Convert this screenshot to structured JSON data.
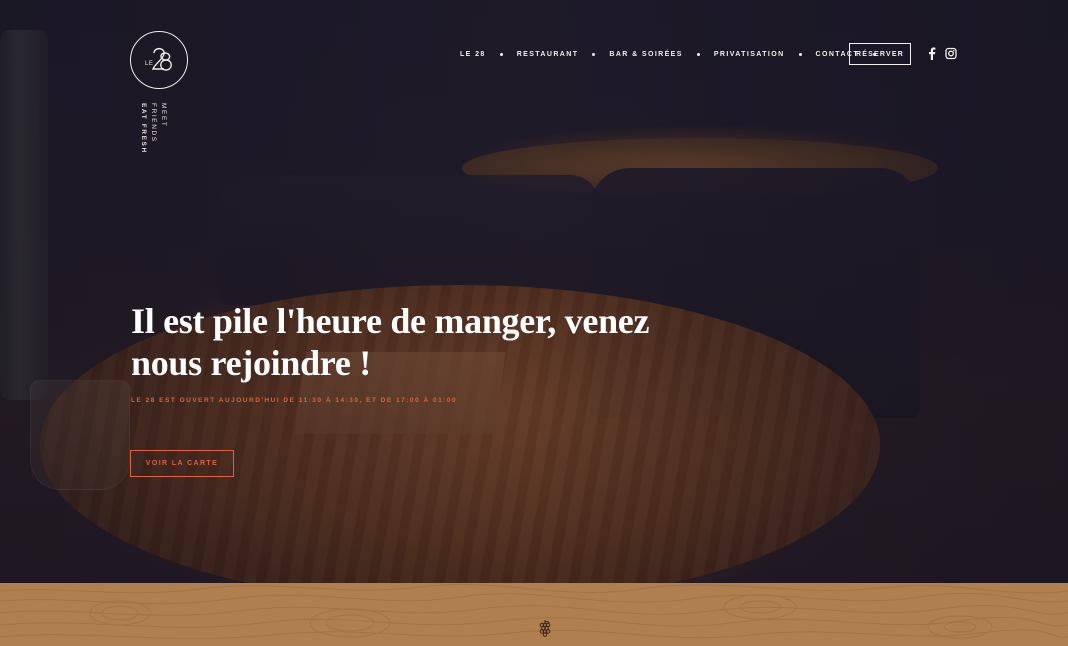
{
  "brand": {
    "logo_text": "LE 28",
    "tagline_line1": "MEET FRIENDS",
    "tagline_line2": "EAT FRESH"
  },
  "nav": {
    "items": [
      {
        "label": "LE 28"
      },
      {
        "label": "RESTAURANT"
      },
      {
        "label": "BAR & SOIRÉES"
      },
      {
        "label": "PRIVATISATION"
      },
      {
        "label": "CONTACT"
      }
    ],
    "reserve_label": "RÉSERVER",
    "social": [
      {
        "icon": "facebook-icon"
      },
      {
        "icon": "instagram-icon"
      }
    ]
  },
  "hero": {
    "headline": "Il est pile l'heure de manger, venez nous rejoindre !",
    "hours": "LE 28 EST OUVERT AUJOURD'HUI DE 11:30 À 14:30, ET DE 17:00 À 01:00",
    "cta_label": "VOIR LA CARTE"
  },
  "colors": {
    "accent": "#d9643e",
    "text": "#ffffff",
    "wood": "#b07f4f",
    "background": "#1b1726"
  }
}
